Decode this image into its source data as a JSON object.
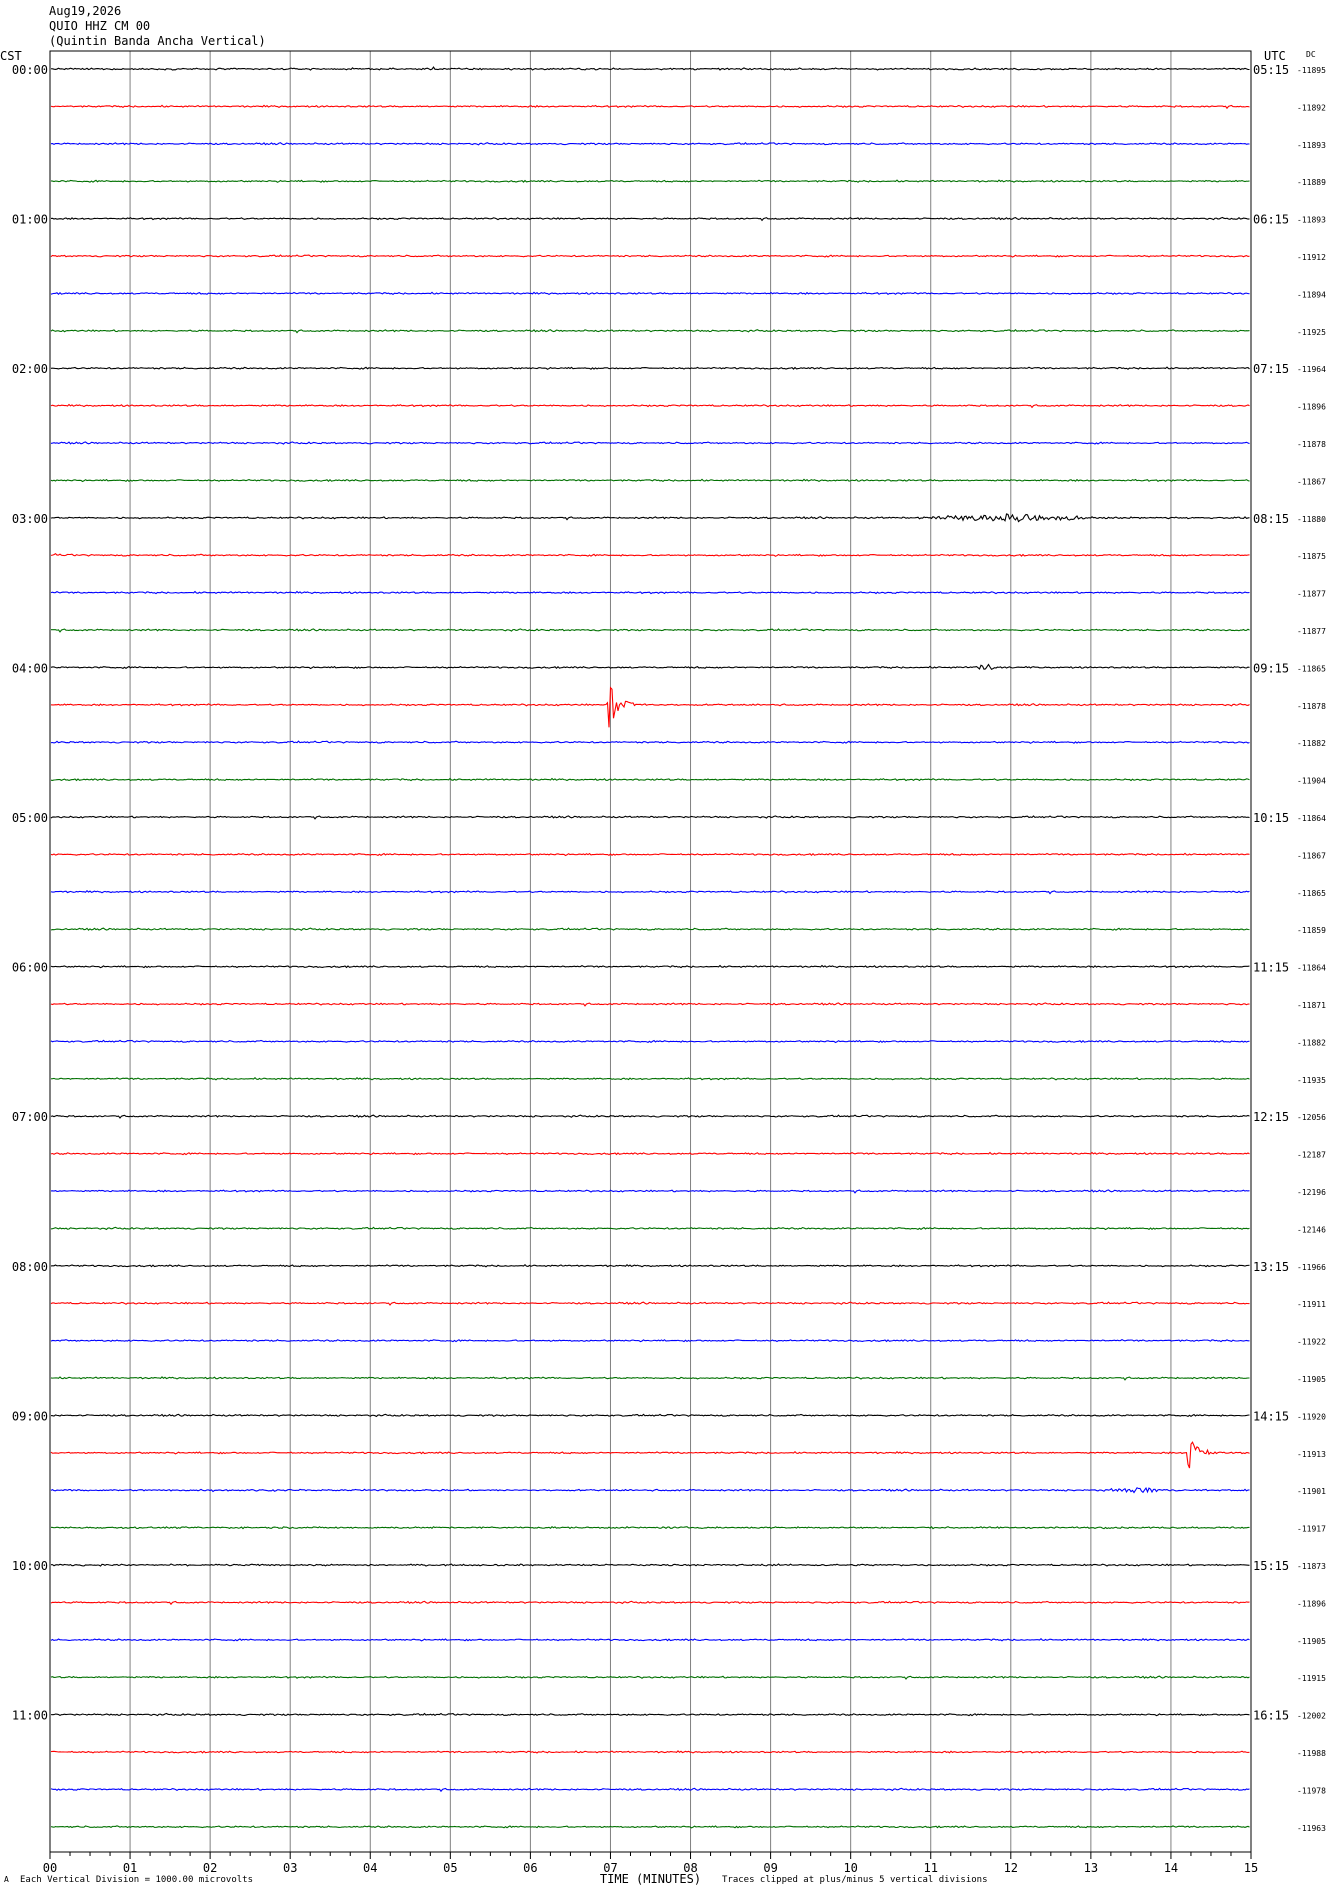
{
  "header": {
    "date": "Aug19,2026",
    "channel": "QUIO HHZ CM 00",
    "station_name": "(Quintin Banda Ancha Vertical)"
  },
  "footer": {
    "scale_note": "Each Vertical Division = 1000.00 microvolts",
    "clip_note": "Traces clipped at plus/minus 5 vertical divisions",
    "corner_mark": "A"
  },
  "colors": {
    "trace_cycle": [
      "#000000",
      "#ff0000",
      "#0000ff",
      "#007000"
    ],
    "grid": "#808080",
    "frame": "#000000"
  },
  "chart_data": {
    "type": "line",
    "subtype": "helicorder",
    "xlabel": "TIME (MINUTES)",
    "left_axis_label": "CST",
    "right_axis_label": "UTC",
    "dc_label": "DC",
    "xlim": [
      0,
      15
    ],
    "x_ticks": [
      "00",
      "01",
      "02",
      "03",
      "04",
      "05",
      "06",
      "07",
      "08",
      "09",
      "10",
      "11",
      "12",
      "13",
      "14",
      "15"
    ],
    "minor_ticks_per_minute": 4,
    "line_minutes": 15,
    "left_hour_labels": [
      "00:00",
      "01:00",
      "02:00",
      "03:00",
      "04:00",
      "05:00",
      "06:00",
      "07:00",
      "08:00",
      "09:00",
      "10:00",
      "11:00"
    ],
    "right_hour_labels": [
      "05:15",
      "06:15",
      "07:15",
      "08:15",
      "09:15",
      "10:15",
      "11:15",
      "12:15",
      "13:15",
      "14:15",
      "15:15",
      "16:15"
    ],
    "dc_values": [
      "-11895",
      "-11892",
      "-11893",
      "-11889",
      "-11893",
      "-11912",
      "-11894",
      "-11925",
      "-11964",
      "-11896",
      "-11878",
      "-11867",
      "-11880",
      "-11875",
      "-11877",
      "-11877",
      "-11865",
      "-11878",
      "-11882",
      "-11904",
      "-11864",
      "-11867",
      "-11865",
      "-11859",
      "-11864",
      "-11871",
      "-11882",
      "-11935",
      "-12056",
      "-12187",
      "-12196",
      "-12146",
      "-11966",
      "-11911",
      "-11922",
      "-11905",
      "-11920",
      "-11913",
      "-11901",
      "-11917",
      "-11873",
      "-11896",
      "-11905",
      "-11915",
      "-12002",
      "-11988",
      "-11978",
      "-11963"
    ],
    "events": [
      {
        "line": 12,
        "start_min": 10.8,
        "end_min": 13.2,
        "amp_div": 0.15,
        "kind": "burst"
      },
      {
        "line": 16,
        "start_min": 11.55,
        "end_min": 11.9,
        "amp_div": 0.35,
        "kind": "spike"
      },
      {
        "line": 17,
        "start_min": 6.95,
        "end_min": 7.6,
        "amp_div": 1.3,
        "kind": "quake"
      },
      {
        "line": 37,
        "start_min": 14.2,
        "end_min": 14.75,
        "amp_div": 0.95,
        "kind": "quake"
      },
      {
        "line": 38,
        "start_min": 13.2,
        "end_min": 14.0,
        "amp_div": 0.12,
        "kind": "burst"
      }
    ]
  }
}
